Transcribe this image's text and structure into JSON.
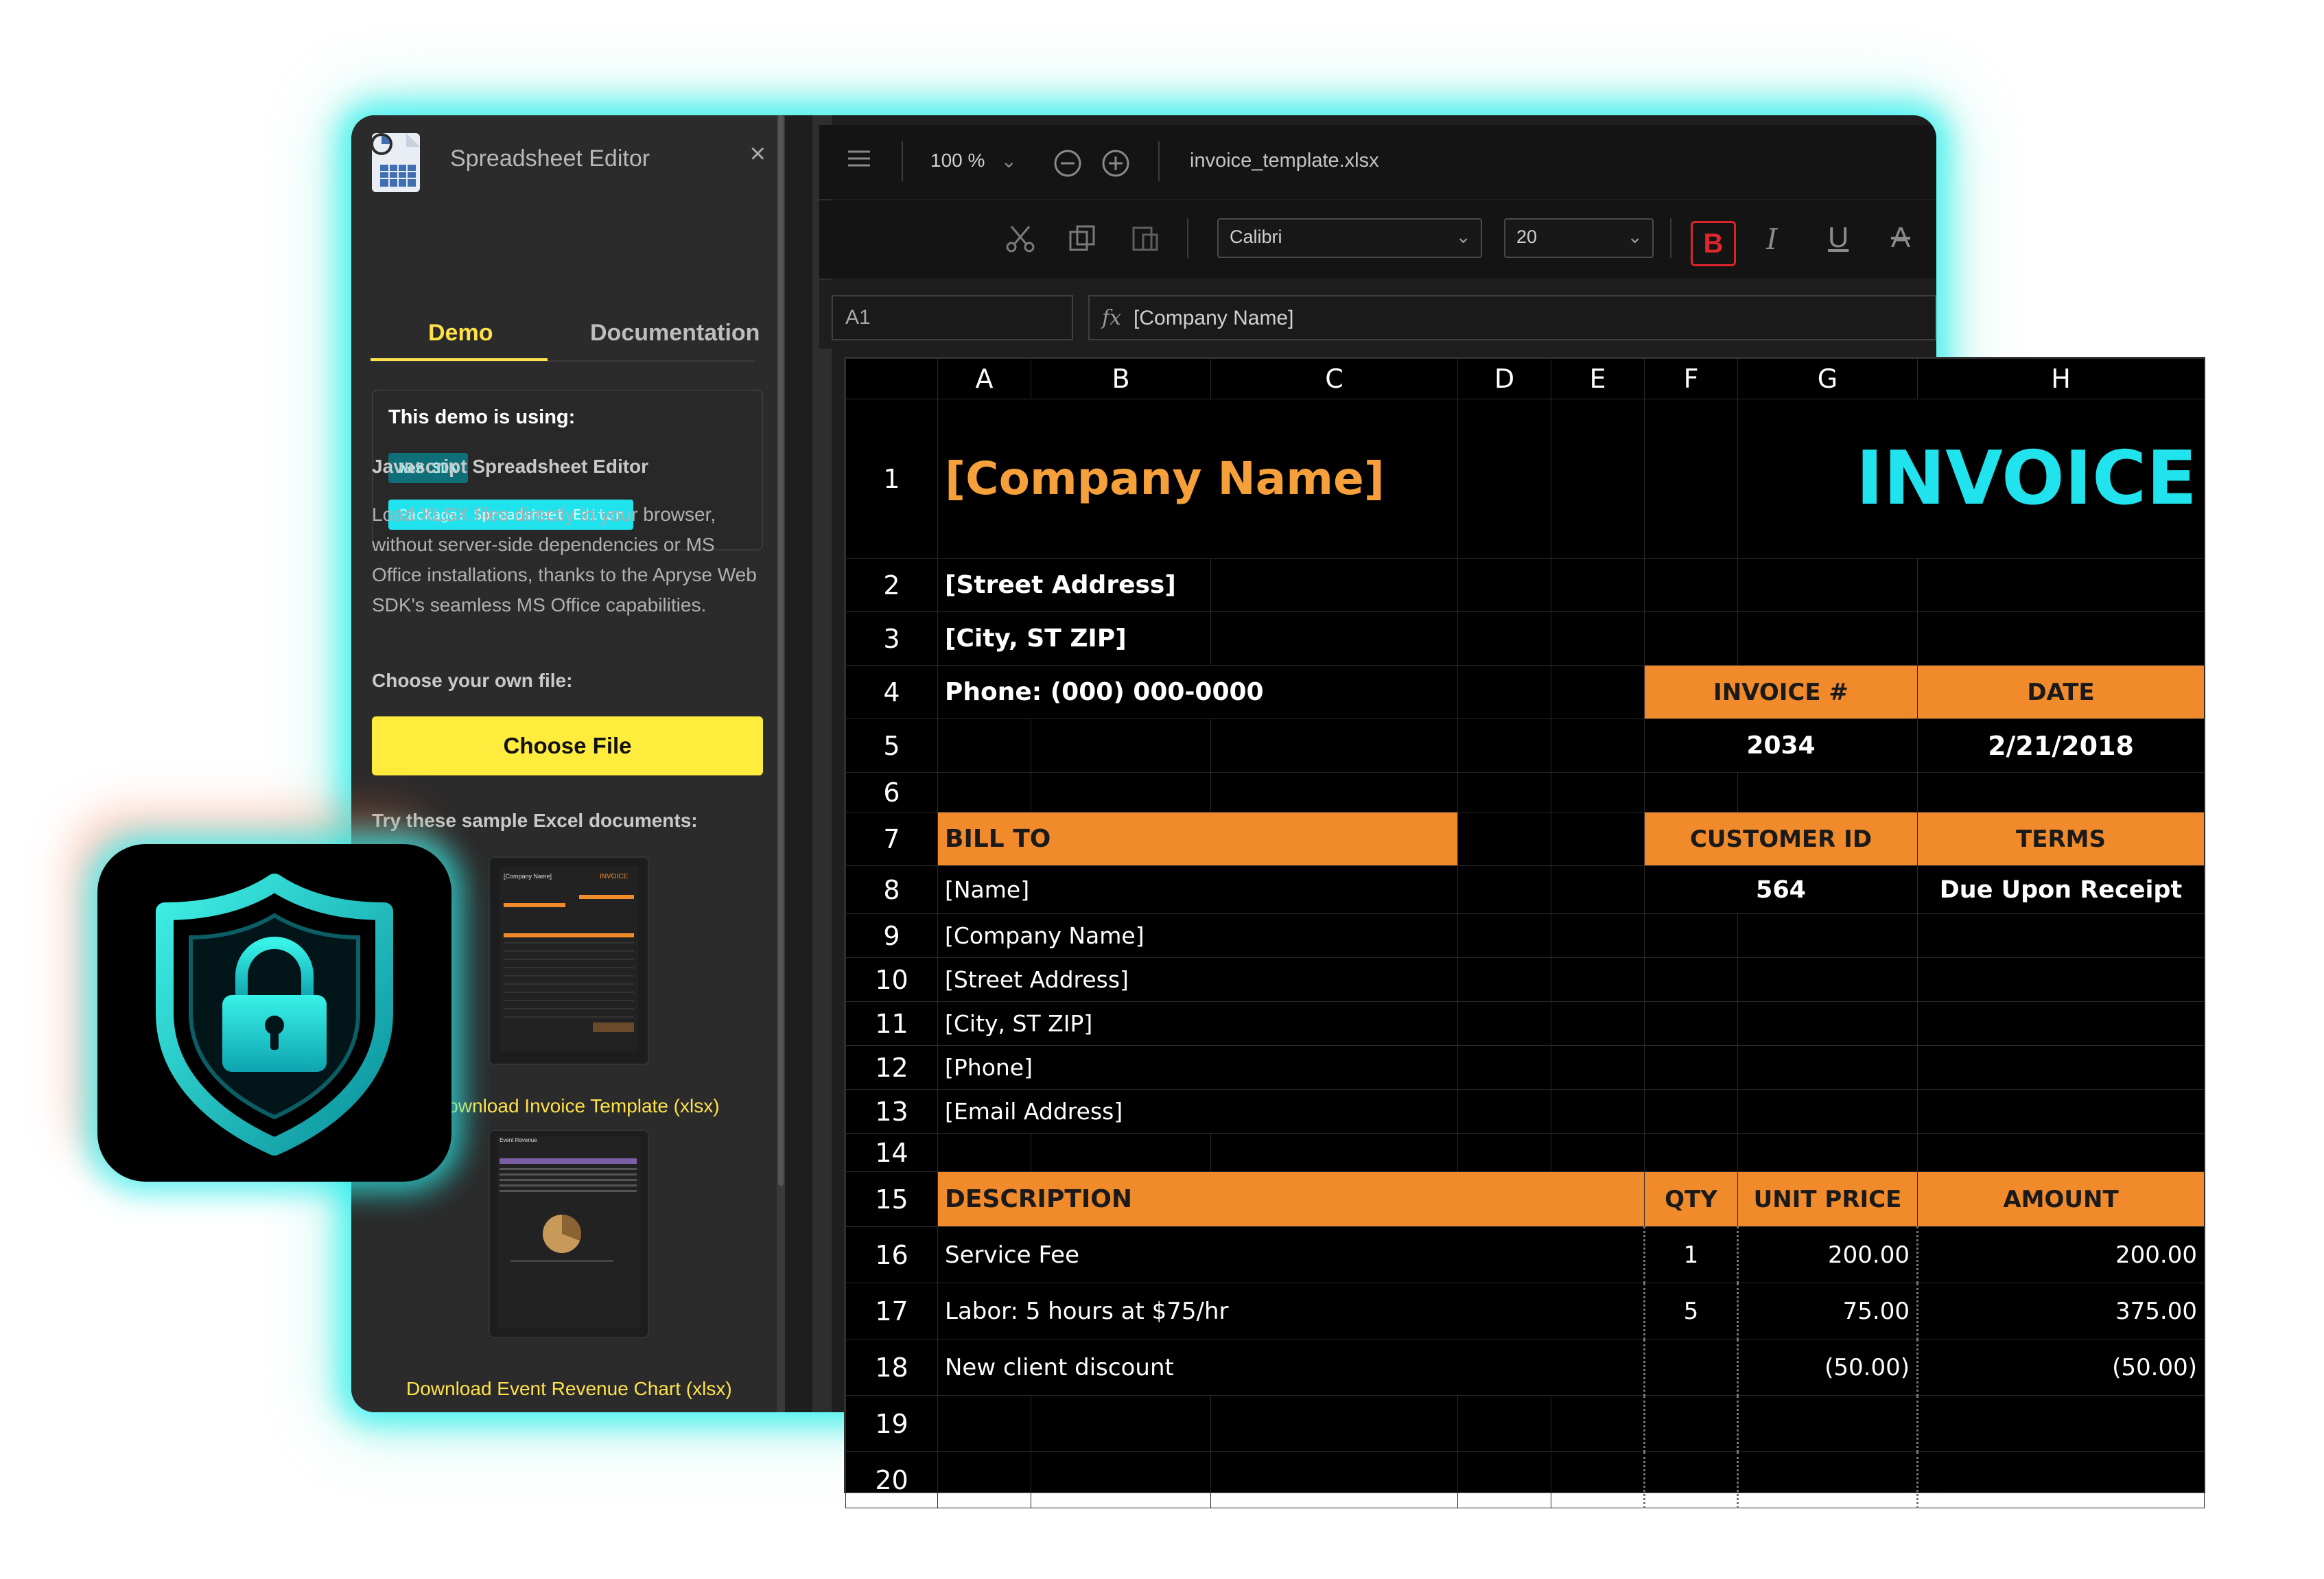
{
  "sidebar": {
    "title": "Spreadsheet Editor",
    "close_label": "×",
    "tabs": [
      {
        "label": "Demo"
      },
      {
        "label": "Documentation"
      }
    ],
    "info_title": "This demo is using:",
    "badges": [
      "Web SDK",
      "Package: Spreadsheet Editor"
    ],
    "heading": "Javascript Spreadsheet Editor",
    "description": "Load XLSX files directly in your browser, without server-side dependencies or MS Office installations, thanks to the Apryse Web SDK's seamless MS Office capabilities.",
    "choose_label": "Choose your own file:",
    "choose_button": "Choose File",
    "samples_label": "Try these sample Excel documents:",
    "samples": [
      {
        "link": "Download Invoice Template (xlsx)",
        "thumb_title": "[Company Name]",
        "thumb_label": "INVOICE"
      },
      {
        "link": "Download Event Revenue Chart (xlsx)",
        "thumb_title": "Event Revenue"
      }
    ]
  },
  "toolbar": {
    "zoom": "100 %",
    "filename": "invoice_template.xlsx",
    "font": "Calibri",
    "font_size": "20",
    "bold_label": "B",
    "italic_label": "I",
    "underline_label": "U",
    "strike_label": "A"
  },
  "formula_bar": {
    "cell_ref": "A1",
    "fx_label": "fx",
    "value": "[Company Name]"
  },
  "sheet": {
    "columns": [
      "A",
      "B",
      "C",
      "D",
      "E",
      "F",
      "G",
      "H"
    ],
    "rows": [
      "1",
      "2",
      "3",
      "4",
      "5",
      "6",
      "7",
      "8",
      "9",
      "10",
      "11",
      "12",
      "13",
      "14",
      "15",
      "16",
      "17",
      "18",
      "19",
      "20"
    ],
    "company": "[Company Name]",
    "invoice_title": "INVOICE",
    "street": "[Street Address]",
    "city": "[City, ST  ZIP]",
    "phone": "Phone: (000) 000-0000",
    "invoice_no_label": "INVOICE #",
    "date_label": "DATE",
    "invoice_no": "2034",
    "date": "2/21/2018",
    "bill_to": "BILL TO",
    "customer_id_label": "CUSTOMER ID",
    "terms_label": "TERMS",
    "bill_name": "[Name]",
    "customer_id": "564",
    "terms": "Due Upon Receipt",
    "bill_company": "[Company Name]",
    "bill_street": "[Street Address]",
    "bill_city": "[City, ST  ZIP]",
    "bill_phone": "[Phone]",
    "bill_email": "[Email Address]",
    "desc_label": "DESCRIPTION",
    "qty_label": "QTY",
    "unit_label": "UNIT PRICE",
    "amount_label": "AMOUNT",
    "items": [
      {
        "desc": "Service Fee",
        "qty": "1",
        "unit": "200.00",
        "amount": "200.00"
      },
      {
        "desc": "Labor: 5 hours at $75/hr",
        "qty": "5",
        "unit": "75.00",
        "amount": "375.00"
      },
      {
        "desc": "New client discount",
        "qty": "",
        "unit": "(50.00)",
        "amount": "(50.00)"
      }
    ]
  },
  "colors": {
    "accent_cyan": "#20e3ee",
    "accent_yellow": "#ffec3d",
    "header_orange": "#f18a2b"
  },
  "icons": [
    "spreadsheet-icon",
    "close-icon",
    "menu-icon",
    "zoom-out-icon",
    "zoom-in-icon",
    "cut-icon",
    "copy-icon",
    "paste-icon",
    "shield-lock-icon"
  ]
}
